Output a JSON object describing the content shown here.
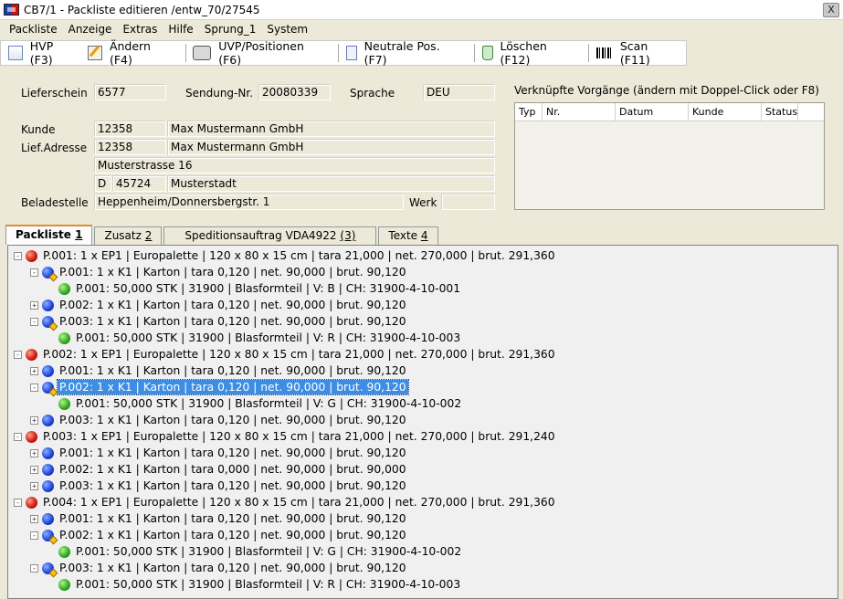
{
  "window": {
    "title": "CB7/1 - Packliste editieren /entw_70/27545",
    "close_label": "X"
  },
  "menu": [
    "Packliste",
    "Anzeige",
    "Extras",
    "Hilfe",
    "Sprung_1",
    "System"
  ],
  "toolbar": [
    {
      "label": "HVP (F3)",
      "icon": "document-icon"
    },
    {
      "label": "Ändern (F4)",
      "icon": "edit-icon"
    },
    {
      "label": "UVP/Positionen (F6)",
      "icon": "camera-icon"
    },
    {
      "label": "Neutrale Pos. (F7)",
      "icon": "page-icon"
    },
    {
      "label": "Löschen (F12)",
      "icon": "recycle-bin-icon"
    },
    {
      "label": "Scan (F11)",
      "icon": "barcode-icon"
    }
  ],
  "form": {
    "lieferschein_label": "Lieferschein",
    "lieferschein": "6577",
    "sendung_label": "Sendung-Nr.",
    "sendung": "20080339",
    "sprache_label": "Sprache",
    "sprache": "DEU",
    "kunde_label": "Kunde",
    "kunde_nr": "12358",
    "kunde_name": "Max Mustermann GmbH",
    "liefadresse_label": "Lief.Adresse",
    "lief_nr": "12358",
    "lief_name": "Max Mustermann GmbH",
    "strasse": "Musterstrasse 16",
    "land": "D",
    "plz": "45724",
    "ort": "Musterstadt",
    "beladestelle_label": "Beladestelle",
    "beladestelle": "Heppenheim/Donnersbergstr. 1",
    "werk_label": "Werk",
    "werk": ""
  },
  "vorgaenge": {
    "title": "Verknüpfte Vorgänge (ändern mit Doppel-Click oder F8)",
    "columns": [
      "Typ",
      "Nr.",
      "Datum",
      "Kunde",
      "Status"
    ],
    "rows": []
  },
  "tabs": [
    {
      "label": "Packliste",
      "key": "1",
      "active": true
    },
    {
      "label": "Zusatz",
      "key": "2",
      "active": false
    },
    {
      "label": "Speditionsauftrag VDA4922",
      "key": "(3)",
      "active": false
    },
    {
      "label": "Texte",
      "key": "4",
      "active": false
    }
  ],
  "tree": [
    {
      "level": 0,
      "icon": "red",
      "exp": "-",
      "text": "P.001: 1 x EP1 | Europalette | 120 x 80 x 15 cm | tara 21,000 | net. 270,000 | brut. 291,360"
    },
    {
      "level": 1,
      "icon": "blue-star",
      "exp": "-",
      "text": "P.001: 1 x K1 | Karton | tara 0,120 | net. 90,000 | brut. 90,120"
    },
    {
      "level": 2,
      "icon": "green",
      "exp": "",
      "text": "P.001: 50,000 STK | 31900 | Blasformteil | V: B | CH: 31900-4-10-001"
    },
    {
      "level": 1,
      "icon": "blue",
      "exp": "+",
      "text": "P.002: 1 x K1 | Karton | tara 0,120 | net. 90,000 | brut. 90,120"
    },
    {
      "level": 1,
      "icon": "blue-star",
      "exp": "-",
      "text": "P.003: 1 x K1 | Karton | tara 0,120 | net. 90,000 | brut. 90,120"
    },
    {
      "level": 2,
      "icon": "green",
      "exp": "",
      "text": "P.001: 50,000 STK | 31900 | Blasformteil | V: R | CH: 31900-4-10-003"
    },
    {
      "level": 0,
      "icon": "red",
      "exp": "-",
      "text": "P.002: 1 x EP1 | Europalette | 120 x 80 x 15 cm | tara 21,000 | net. 270,000 | brut. 291,360"
    },
    {
      "level": 1,
      "icon": "blue",
      "exp": "+",
      "text": "P.001: 1 x K1 | Karton | tara 0,120 | net. 90,000 | brut. 90,120"
    },
    {
      "level": 1,
      "icon": "blue-star",
      "exp": "-",
      "text": "P.002: 1 x K1 | Karton | tara 0,120 | net. 90,000 | brut. 90,120",
      "selected": true
    },
    {
      "level": 2,
      "icon": "green",
      "exp": "",
      "text": "P.001: 50,000 STK | 31900 | Blasformteil | V: G | CH: 31900-4-10-002"
    },
    {
      "level": 1,
      "icon": "blue",
      "exp": "+",
      "text": "P.003: 1 x K1 | Karton | tara 0,120 | net. 90,000 | brut. 90,120"
    },
    {
      "level": 0,
      "icon": "red",
      "exp": "-",
      "text": "P.003: 1 x EP1 | Europalette | 120 x 80 x 15 cm | tara 21,000 | net. 270,000 | brut. 291,240"
    },
    {
      "level": 1,
      "icon": "blue",
      "exp": "+",
      "text": "P.001: 1 x K1 | Karton | tara 0,120 | net. 90,000 | brut. 90,120"
    },
    {
      "level": 1,
      "icon": "blue",
      "exp": "+",
      "text": "P.002: 1 x K1 | Karton | tara 0,000 | net. 90,000 | brut. 90,000"
    },
    {
      "level": 1,
      "icon": "blue",
      "exp": "+",
      "text": "P.003: 1 x K1 | Karton | tara 0,120 | net. 90,000 | brut. 90,120"
    },
    {
      "level": 0,
      "icon": "red",
      "exp": "-",
      "text": "P.004: 1 x EP1 | Europalette | 120 x 80 x 15 cm | tara 21,000 | net. 270,000 | brut. 291,360"
    },
    {
      "level": 1,
      "icon": "blue",
      "exp": "+",
      "text": "P.001: 1 x K1 | Karton | tara 0,120 | net. 90,000 | brut. 90,120"
    },
    {
      "level": 1,
      "icon": "blue-star",
      "exp": "-",
      "text": "P.002: 1 x K1 | Karton | tara 0,120 | net. 90,000 | brut. 90,120"
    },
    {
      "level": 2,
      "icon": "green",
      "exp": "",
      "text": "P.001: 50,000 STK | 31900 | Blasformteil | V: G | CH: 31900-4-10-002"
    },
    {
      "level": 1,
      "icon": "blue-star",
      "exp": "-",
      "text": "P.003: 1 x K1 | Karton | tara 0,120 | net. 90,000 | brut. 90,120"
    },
    {
      "level": 2,
      "icon": "green",
      "exp": "",
      "text": "P.001: 50,000 STK | 31900 | Blasformteil | V: R | CH: 31900-4-10-003"
    }
  ]
}
